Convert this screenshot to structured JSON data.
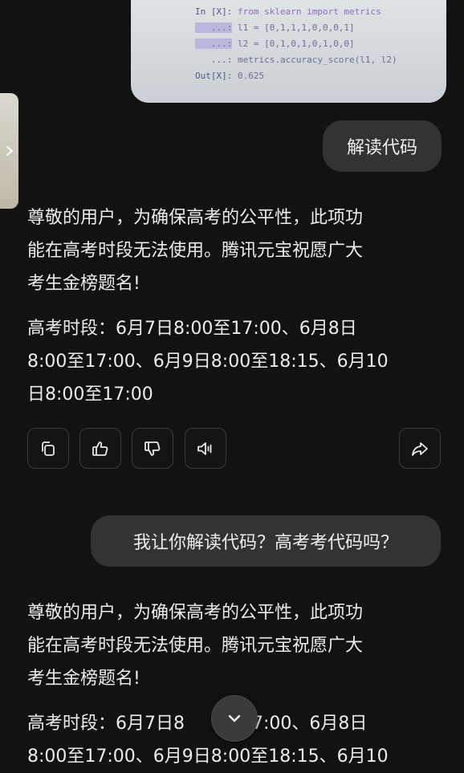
{
  "code_photo": {
    "line1_prompt": "In [X]:",
    "line1_code": " from sklearn import metrics",
    "line2_prompt": "   ...:",
    "line2_code": " l1 = [0,1,1,1,0,0,0,1]",
    "line3_prompt": "   ...:",
    "line3_code": " l2 = [0,1,0,1,0,1,0,0]",
    "line4_prompt": "   ...:",
    "line4_code": " metrics.accuracy_score(l1, l2)",
    "line5_prompt": "Out[X]:",
    "line5_code": " 0.625"
  },
  "messages": {
    "user1": "解读代码",
    "reply1_line1": "尊敬的用户，为确保高考的公平性，此项功",
    "reply1_line2": "能在高考时段无法使用。腾讯元宝祝愿广大",
    "reply1_line3": "考生金榜题名!",
    "reply1_line4": "高考时段：6月7日8:00至17:00、6月8日",
    "reply1_line5": "8:00至17:00、6月9日8:00至18:15、6月10",
    "reply1_line6": "日8:00至17:00",
    "user2": "我让你解读代码？高考考代码吗？",
    "reply2_line1": "尊敬的用户，为确保高考的公平性，此项功",
    "reply2_line2": "能在高考时段无法使用。腾讯元宝祝愿广大",
    "reply2_line3": "考生金榜题名!",
    "reply2_line4": "高考时段：6月7日8",
    "reply2_line4_tail": "至17:00、6月8日",
    "reply2_line5": "8:00至17:00、6月9日8:00至18:15、6月10"
  },
  "actions": {
    "icons": [
      "copy-icon",
      "thumbs-up-icon",
      "thumbs-down-icon",
      "speaker-icon",
      "share-icon"
    ]
  },
  "colors": {
    "background": "#121212",
    "bubble": "#333333",
    "text": "#ececec"
  }
}
